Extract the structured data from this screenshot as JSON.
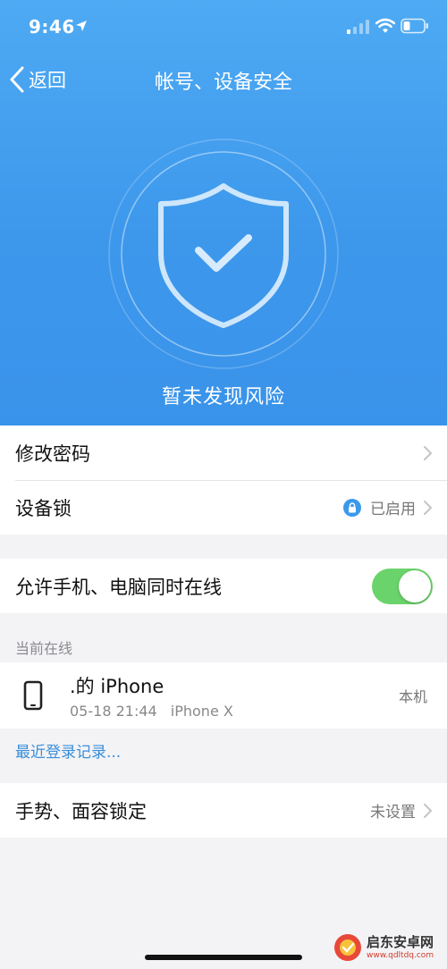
{
  "status_bar": {
    "time": "9:46",
    "icons": [
      "location-arrow-icon",
      "signal-icon",
      "wifi-icon",
      "battery-icon"
    ]
  },
  "nav": {
    "back_label": "返回",
    "title": "帐号、设备安全"
  },
  "hero": {
    "status_text": "暂未发现风险",
    "icon": "shield-check-icon",
    "background_top": "#4eaaf3",
    "background_bottom": "#3a93ea"
  },
  "security": {
    "change_password": "修改密码",
    "device_lock": "设备锁",
    "device_lock_status": "已启用"
  },
  "online": {
    "allow_simultaneous_label": "允许手机、电脑同时在线",
    "allow_simultaneous_enabled": true,
    "toggle_color": "#6bd36b"
  },
  "current_online": {
    "header": "当前在线",
    "device_name": ".的 iPhone",
    "login_time": "05-18 21:44",
    "device_model": "iPhone X",
    "tag": "本机"
  },
  "recent_login_link": "最近登录记录...",
  "gesture": {
    "label": "手势、面容锁定",
    "status": "未设置"
  },
  "watermark": {
    "name": "启东安卓网",
    "url": "www.qdltdq.com"
  },
  "accent_color": "#3a8fd9"
}
